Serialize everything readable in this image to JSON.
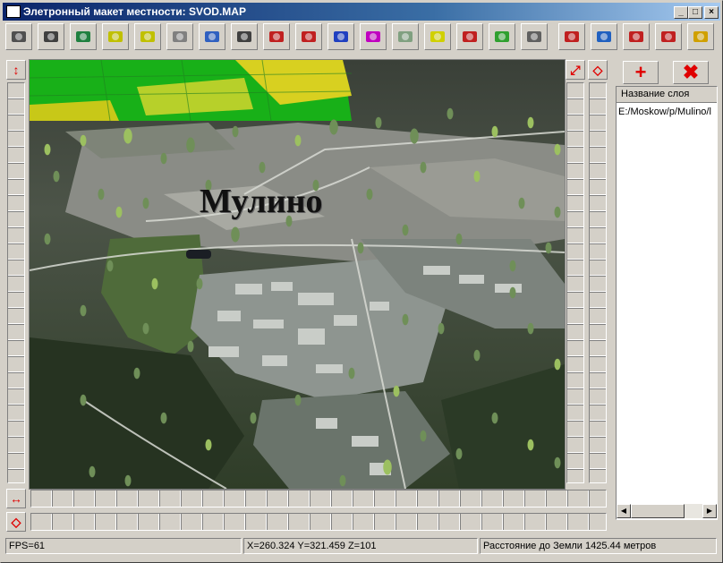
{
  "window": {
    "title": "Элетронный макет местности: SVOD.MAP",
    "controls": [
      "_",
      "□",
      "×"
    ]
  },
  "toolbar": {
    "tools": [
      {
        "icon": "open-folder-icon",
        "color": "#505050"
      },
      {
        "icon": "save-disk-icon",
        "color": "#404040"
      },
      {
        "icon": "layers-transfer-icon",
        "color": "#208040"
      },
      {
        "icon": "zoom-in-icon",
        "color": "#c0c000"
      },
      {
        "icon": "zoom-out-icon",
        "color": "#c0c000"
      },
      {
        "icon": "settings-gear-icon",
        "color": "#808080"
      },
      {
        "icon": "layers-stack-icon",
        "color": "#3060c0"
      },
      {
        "icon": "road-sign-icon",
        "color": "#404040"
      },
      {
        "icon": "vehicle-icon",
        "color": "#c02020"
      },
      {
        "icon": "vehicle-red-icon",
        "color": "#c02020"
      },
      {
        "icon": "info-pointer-icon",
        "color": "#2040c0"
      },
      {
        "icon": "polygon-paint-icon",
        "color": "#c000c0"
      },
      {
        "icon": "map-grid-icon",
        "color": "#80a080"
      },
      {
        "icon": "eraser-icon",
        "color": "#d0d000"
      },
      {
        "icon": "ruler-measure-icon",
        "color": "#c02020"
      },
      {
        "icon": "map-book-icon",
        "color": "#30a030"
      },
      {
        "icon": "terrain-icon",
        "color": "#606060"
      },
      {
        "icon": "profile-line-icon",
        "color": "#c02020"
      },
      {
        "icon": "house-globe-icon",
        "color": "#2060c0"
      },
      {
        "icon": "map-edit-icon",
        "color": "#c02020"
      },
      {
        "icon": "compass-axes-icon",
        "color": "#c02020"
      },
      {
        "icon": "help-icon",
        "color": "#d0a000"
      }
    ]
  },
  "map": {
    "label": "Мулино"
  },
  "layers": {
    "add_label": "+",
    "delete_label": "✖",
    "column_header": "Название слоя",
    "items": [
      "E:/Moskow/p/Mulino/l"
    ]
  },
  "status": {
    "fps": "FPS=61",
    "coords": "X=260.324 Y=321.459 Z=101",
    "distance": "Расстояние до Земли 1425.44 метров"
  },
  "colors": {
    "accent_red": "#e00000",
    "title_start": "#0a246a",
    "title_end": "#a6caf0"
  }
}
